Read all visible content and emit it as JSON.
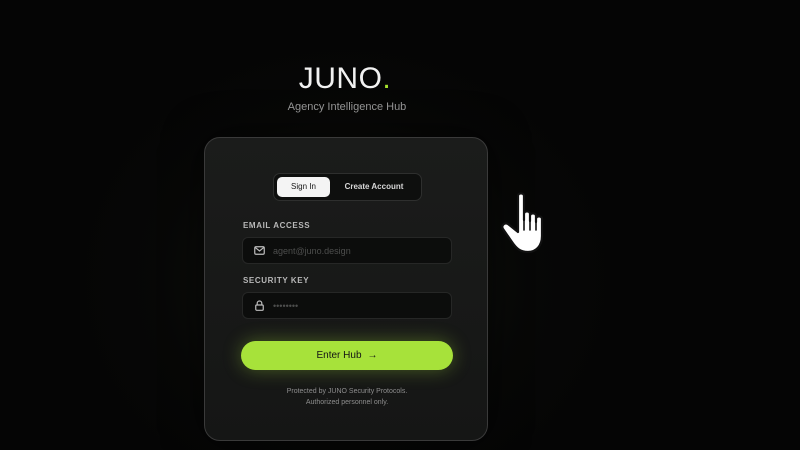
{
  "brand": {
    "name": "JUNO",
    "dot": ".",
    "tagline": "Agency Intelligence Hub",
    "accent_color": "#a7e23a"
  },
  "tabs": [
    {
      "label": "Sign In",
      "active": true
    },
    {
      "label": "Create Account",
      "active": false
    }
  ],
  "email": {
    "label": "EMAIL ACCESS",
    "placeholder": "agent@juno.design",
    "value": "",
    "icon": "mail-icon"
  },
  "security": {
    "label": "SECURITY KEY",
    "placeholder": "••••••••",
    "value": "",
    "icon": "lock-icon"
  },
  "submit": {
    "label": "Enter Hub",
    "arrow": "→"
  },
  "footer": {
    "line1": "Protected by JUNO Security Protocols.",
    "line2": "Authorized personnel only."
  },
  "cursor": {
    "icon": "hand-pointer-icon"
  }
}
